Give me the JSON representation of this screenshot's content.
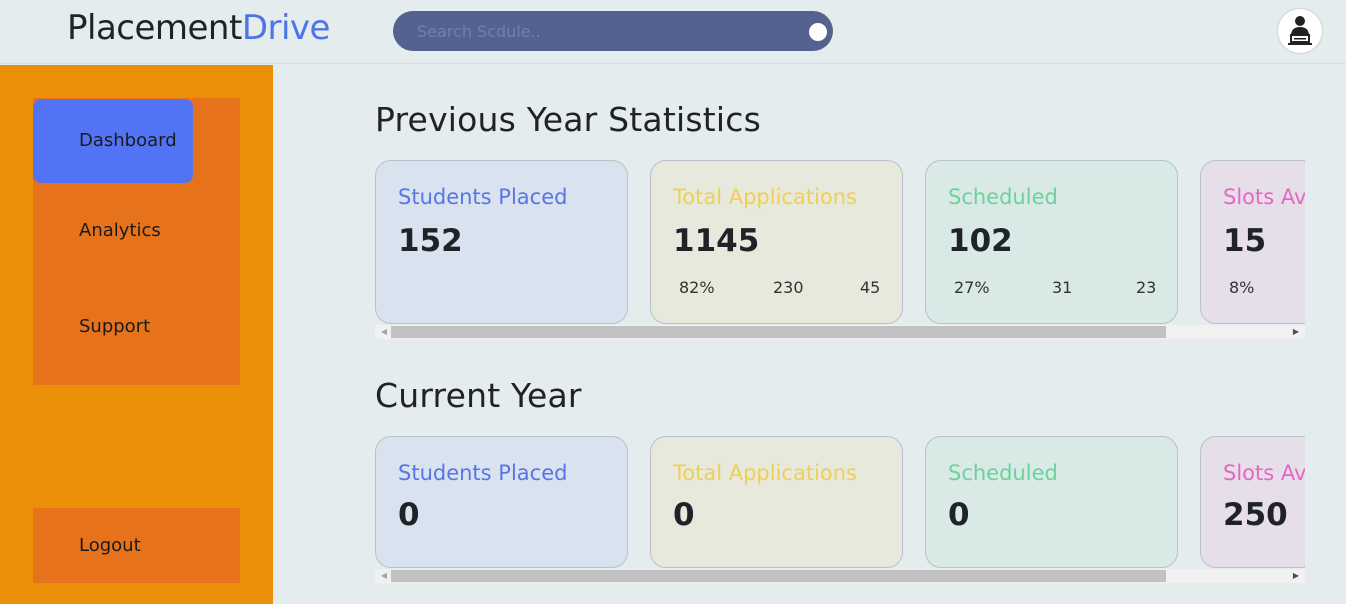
{
  "brand": {
    "part1": "Placement",
    "part2": "Drive"
  },
  "search": {
    "placeholder": "Search Scdule.."
  },
  "sidebar": {
    "items": [
      {
        "label": "Dashboard"
      },
      {
        "label": "Analytics"
      },
      {
        "label": "Support"
      }
    ],
    "logout": "Logout"
  },
  "previous": {
    "title": "Previous Year Statistics",
    "cards": [
      {
        "label": "Students Placed",
        "value": "152",
        "stats": [
          "",
          "",
          ""
        ]
      },
      {
        "label": "Total Applications",
        "value": "1145",
        "stats": [
          "82%",
          "230",
          "45"
        ]
      },
      {
        "label": "Scheduled",
        "value": "102",
        "stats": [
          "27%",
          "31",
          "23"
        ]
      },
      {
        "label": "Slots Available",
        "value": "15",
        "stats": [
          "8%",
          "",
          ""
        ]
      }
    ]
  },
  "current": {
    "title": "Current Year",
    "cards": [
      {
        "label": "Students Placed",
        "value": "0"
      },
      {
        "label": "Total Applications",
        "value": "0"
      },
      {
        "label": "Scheduled",
        "value": "0"
      },
      {
        "label": "Slots Available",
        "value": "250"
      }
    ]
  },
  "colors": {
    "sidebar": "#eb8e08",
    "nav_panel": "#e6731c",
    "active_item": "#5373f5",
    "search_bar": "#55628f",
    "accent_blue": "#4e74e6"
  }
}
